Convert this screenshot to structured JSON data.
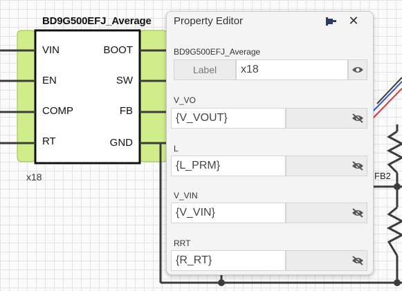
{
  "component": {
    "title": "BD9G500EFJ_Average",
    "reference": "x18",
    "pins_left": [
      "VIN",
      "EN",
      "COMP",
      "RT"
    ],
    "pins_right": [
      "BOOT",
      "SW",
      "FB",
      "GND"
    ]
  },
  "net_labels": {
    "fb2": "FB2"
  },
  "property_editor": {
    "title": "Property Editor",
    "component_name": "BD9G500EFJ_Average",
    "label_field": {
      "tag": "Label",
      "value": "x18",
      "visibility": "eye-icon"
    },
    "properties": [
      {
        "name": "V_VO",
        "value": "{V_VOUT}",
        "visibility": "eye-off-icon"
      },
      {
        "name": "L",
        "value": "{L_PRM}",
        "visibility": "eye-off-icon"
      },
      {
        "name": "V_VIN",
        "value": "{V_VIN}",
        "visibility": "eye-off-icon"
      },
      {
        "name": "RRT",
        "value": "{R_RT}",
        "visibility": "eye-off-icon"
      }
    ]
  },
  "colors": {
    "pin_highlight": "#cfee8a",
    "wire": "#3c3c3c",
    "wire_blue": "#3b57c9",
    "wire_red": "#d43a3a",
    "panel_bg": "#f4f4f4"
  }
}
